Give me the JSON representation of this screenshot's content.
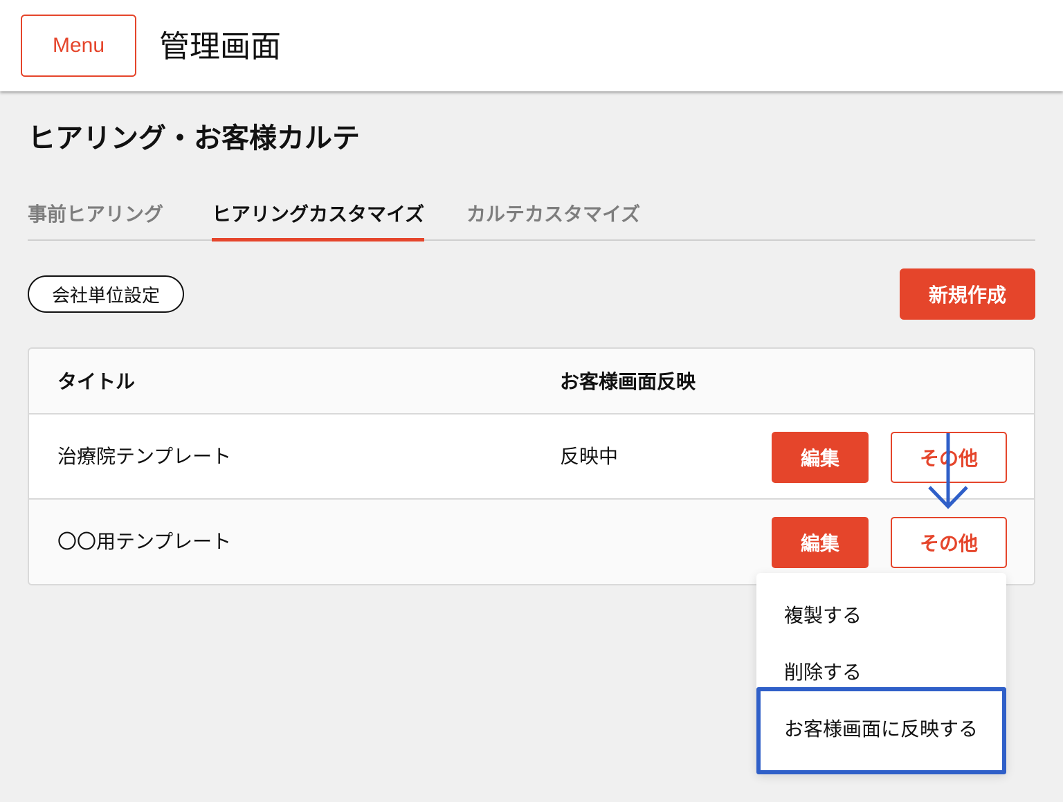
{
  "header": {
    "menu_label": "Menu",
    "title": "管理画面"
  },
  "page": {
    "title": "ヒアリング・お客様カルテ"
  },
  "tabs": [
    {
      "label": "事前ヒアリング",
      "active": false
    },
    {
      "label": "ヒアリングカスタマイズ",
      "active": true
    },
    {
      "label": "カルテカスタマイズ",
      "active": false
    }
  ],
  "toolbar": {
    "company_settings_label": "会社単位設定",
    "new_label": "新規作成"
  },
  "table": {
    "columns": [
      "タイトル",
      "お客様画面反映"
    ],
    "rows": [
      {
        "title": "治療院テンプレート",
        "reflection": "反映中",
        "edit_label": "編集",
        "other_label": "その他"
      },
      {
        "title": "〇〇用テンプレート",
        "reflection": "",
        "edit_label": "編集",
        "other_label": "その他"
      }
    ]
  },
  "dropdown": {
    "items": [
      "複製する",
      "削除する",
      "お客様画面に反映する"
    ],
    "highlighted_index": 2
  },
  "colors": {
    "accent": "#e5452b",
    "annotation": "#2f5fc8",
    "background": "#f0f0f0"
  }
}
